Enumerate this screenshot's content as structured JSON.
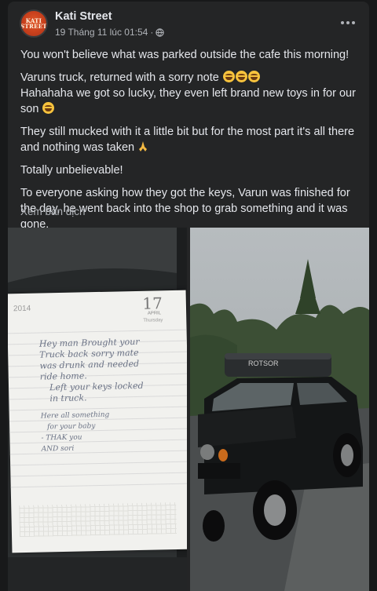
{
  "post": {
    "author": "Kati Street",
    "logo_text": "KATI STREET",
    "timestamp": "19 Tháng 11 lúc 01:54",
    "separator": "·",
    "privacy_icon": "globe-icon",
    "more_icon": "more-options-icon"
  },
  "body": {
    "p1": "You won't believe what was parked outside the cafe this morning!",
    "p2_line1": "Varuns truck, returned with a sorry note",
    "p2_line2": "Hahahaha we got so lucky, they even left brand new toys in for our son",
    "p3": "They still mucked with it a little bit but for the most part it's all there and nothing was taken",
    "p4": "Totally unbelievable!",
    "p5": "To everyone asking how they got the keys, Varun was finished for the day, he went back into the shop to grab something and it was gone."
  },
  "translate_label": "Xem bản dịch",
  "photo_note": {
    "year": "2014",
    "day": "17",
    "month": "APRIL",
    "weekday": "Thursday",
    "lines": [
      "Hey man Brought your",
      "Truck back sorry mate",
      "was drunk and needed",
      "ride home.",
      "Left your keys locked",
      "in truck.",
      "Here all something",
      "for your baby",
      "- THAK you",
      "AND sori"
    ]
  },
  "photo_truck": {
    "roof_text": "ROTSOR"
  },
  "colors": {
    "background": "#18191a",
    "card": "#242526",
    "text_primary": "#e4e6eb",
    "text_secondary": "#b0b3b8"
  }
}
